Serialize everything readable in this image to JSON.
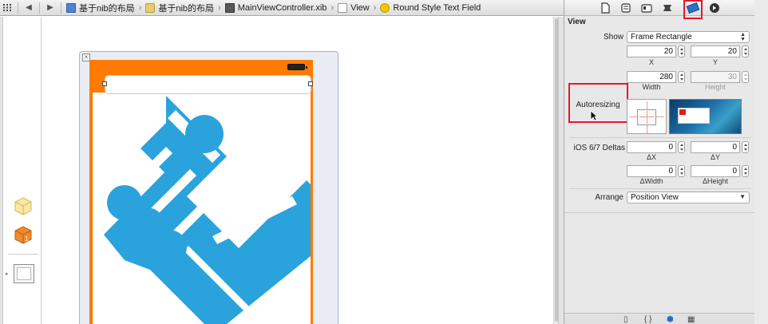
{
  "jumpbar": {
    "breadcrumbs": [
      {
        "label": "基于nib的布局",
        "icon": "project-icon"
      },
      {
        "label": "基于nib的布局",
        "icon": "folder-icon"
      },
      {
        "label": "MainViewController.xib",
        "icon": "xib-file-icon"
      },
      {
        "label": "View",
        "icon": "view-icon"
      },
      {
        "label": "Round Style Text Field",
        "icon": "text-field-icon"
      }
    ]
  },
  "inspector": {
    "tabs": [
      "file-inspector-icon",
      "quick-help-icon",
      "identity-inspector-icon",
      "attributes-inspector-icon",
      "size-inspector-icon",
      "connections-inspector-icon"
    ],
    "selected_tab": "size-inspector-icon",
    "section_title": "View",
    "show": {
      "label": "Show",
      "value": "Frame Rectangle"
    },
    "frame": {
      "x": {
        "value": "20",
        "caption": "X"
      },
      "y": {
        "value": "20",
        "caption": "Y"
      },
      "width": {
        "value": "280",
        "caption": "Width"
      },
      "height": {
        "value": "30",
        "caption": "Height"
      }
    },
    "autoresizing_label": "Autoresizing",
    "deltas": {
      "label": "iOS 6/7 Deltas",
      "dx": {
        "value": "0",
        "caption": "ΔX"
      },
      "dy": {
        "value": "0",
        "caption": "ΔY"
      },
      "dwidth": {
        "value": "0",
        "caption": "ΔWidth"
      },
      "dheight": {
        "value": "0",
        "caption": "ΔHeight"
      }
    },
    "arrange": {
      "label": "Arrange",
      "value": "Position View"
    },
    "library_tabs": [
      "file-template-icon",
      "code-snippet-icon",
      "object-library-icon",
      "media-library-icon"
    ]
  },
  "colors": {
    "device_background": "#ff7a00",
    "logo_blue": "#2aa3dd",
    "highlight_red": "#e3192a"
  }
}
